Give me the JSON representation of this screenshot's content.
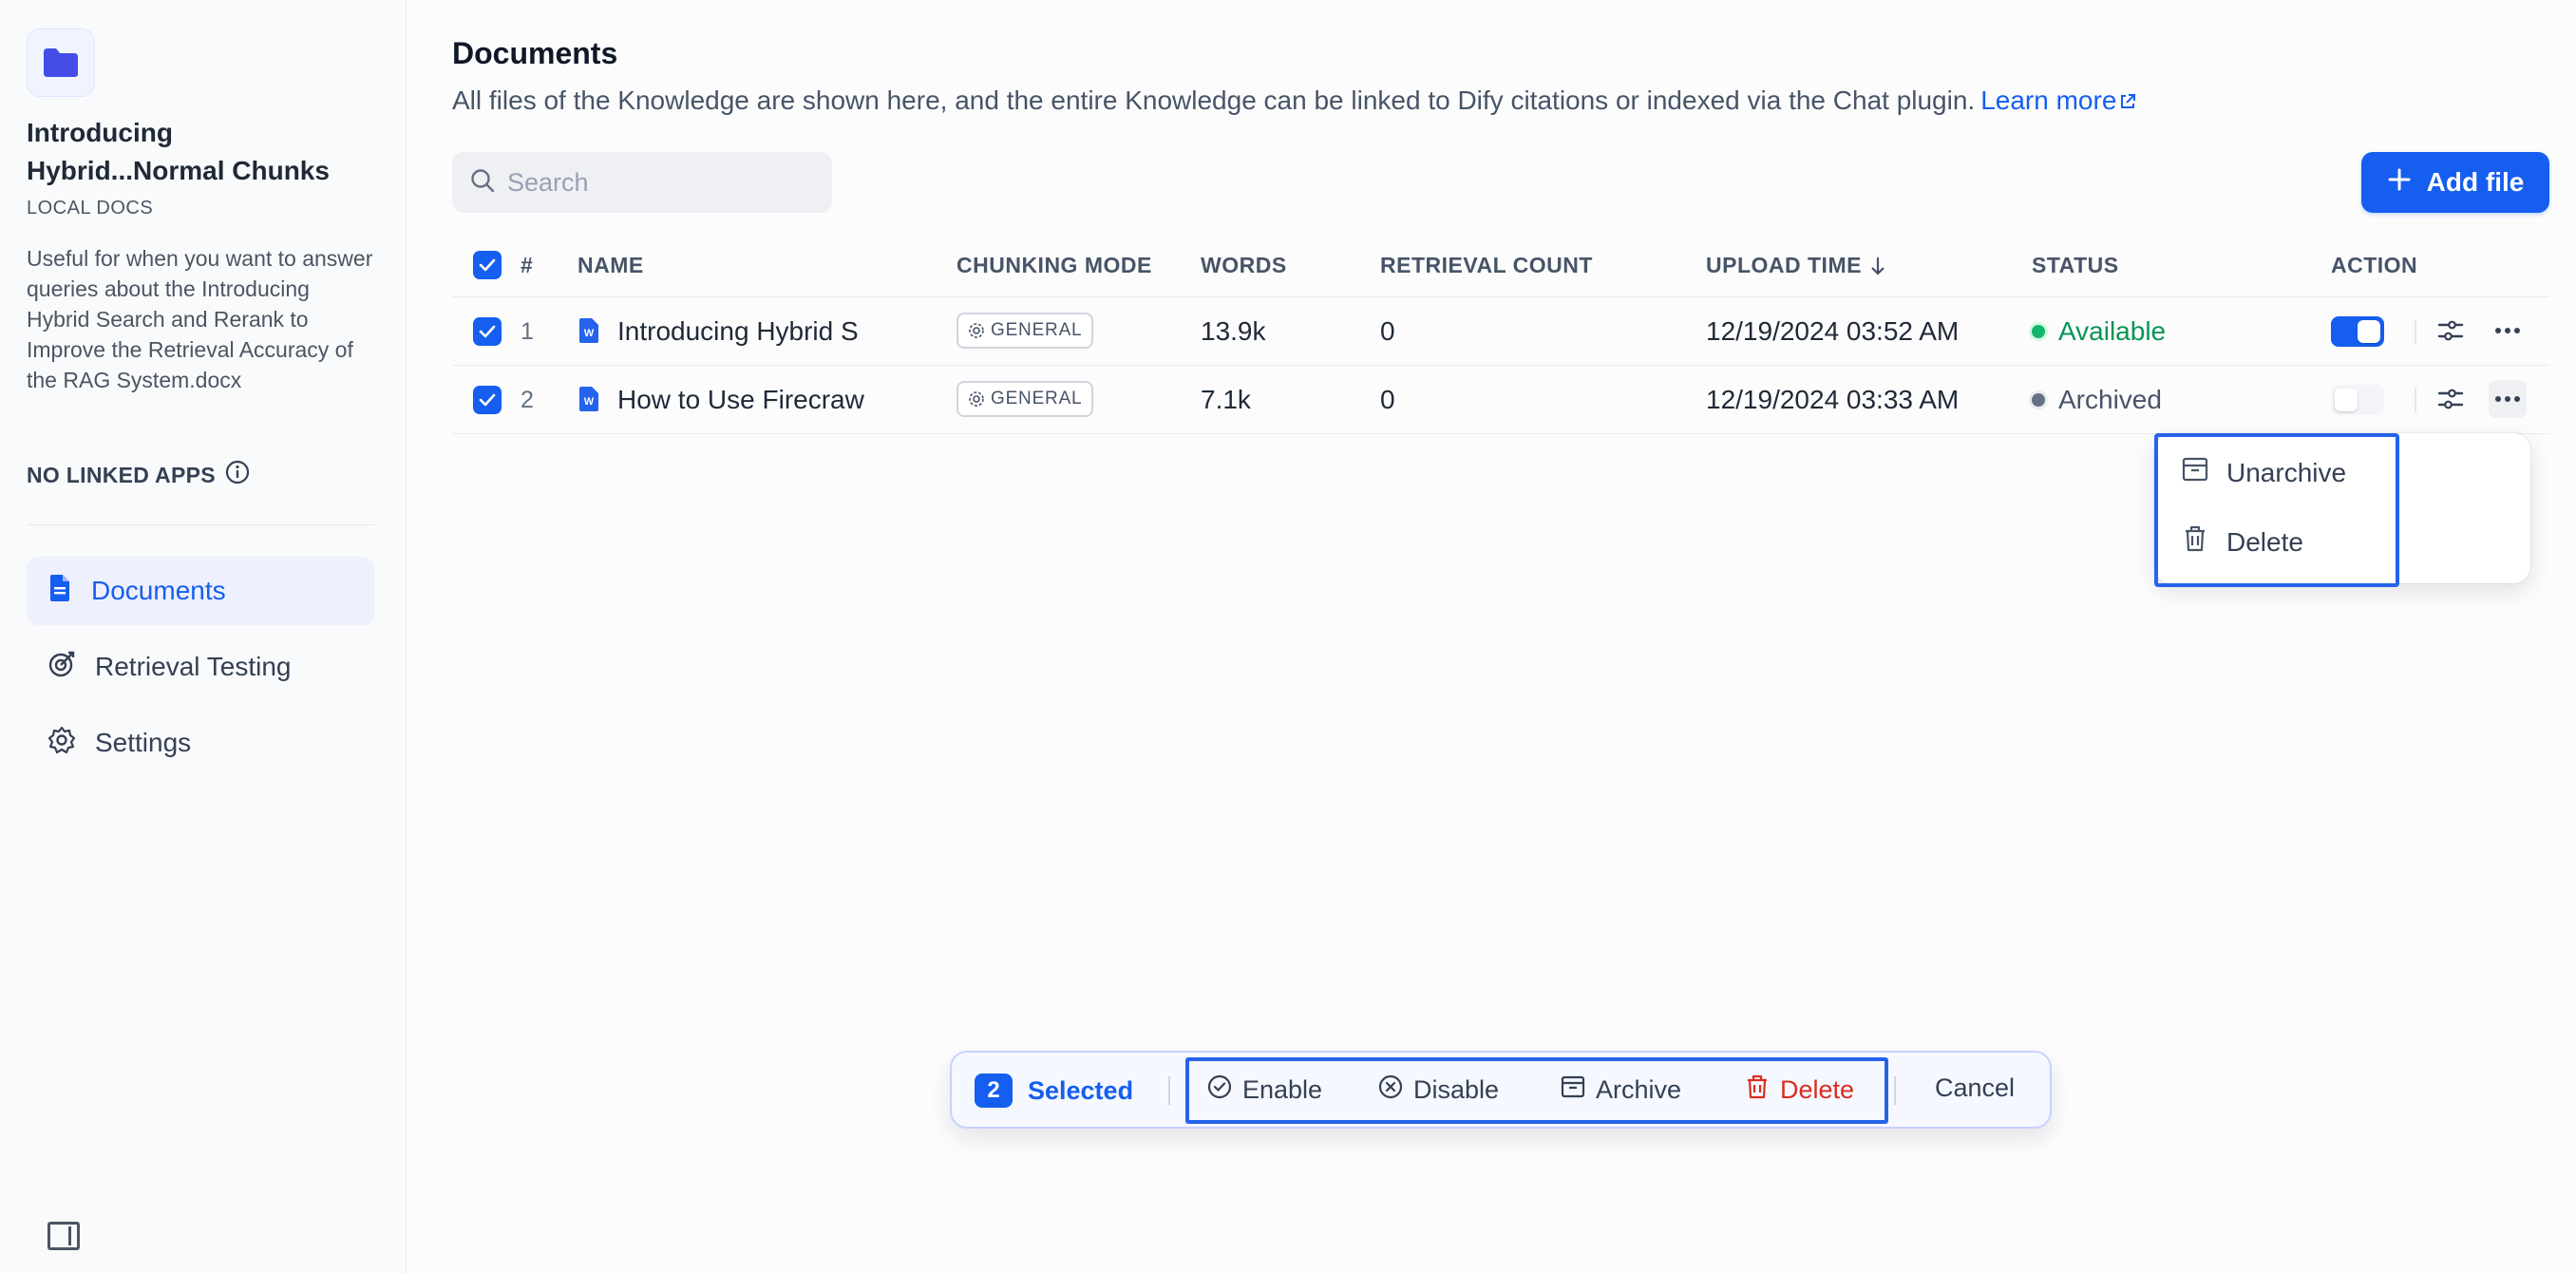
{
  "sidebar": {
    "dataset_title": "Introducing Hybrid...Normal Chunks",
    "dataset_source": "LOCAL DOCS",
    "dataset_description": "Useful for when you want to answer queries about the Introducing Hybrid Search and Rerank to Improve the Retrieval Accuracy of the RAG System.docx",
    "linked_apps_label": "NO LINKED APPS",
    "nav": [
      {
        "label": "Documents",
        "icon": "document-icon",
        "active": true
      },
      {
        "label": "Retrieval Testing",
        "icon": "target-icon",
        "active": false
      },
      {
        "label": "Settings",
        "icon": "gear-icon",
        "active": false
      }
    ]
  },
  "header": {
    "title": "Documents",
    "description": "All files of the Knowledge are shown here, and the entire Knowledge can be linked to Dify citations or indexed via the Chat plugin.",
    "learn_more": "Learn more"
  },
  "toolbar": {
    "search_placeholder": "Search",
    "add_file_label": "Add file"
  },
  "table": {
    "columns": {
      "index": "#",
      "name": "NAME",
      "chunking": "CHUNKING MODE",
      "words": "WORDS",
      "retrieval": "RETRIEVAL COUNT",
      "upload": "UPLOAD TIME",
      "status": "STATUS",
      "action": "ACTION"
    },
    "rows": [
      {
        "index": "1",
        "name": "Introducing Hybrid S",
        "chunking": "GENERAL",
        "words": "13.9k",
        "retrieval": "0",
        "upload_time": "12/19/2024 03:52 AM",
        "status": "Available",
        "enabled": true
      },
      {
        "index": "2",
        "name": "How to Use Firecraw",
        "chunking": "GENERAL",
        "words": "7.1k",
        "retrieval": "0",
        "upload_time": "12/19/2024 03:33 AM",
        "status": "Archived",
        "enabled": false
      }
    ]
  },
  "row_menu": {
    "unarchive": "Unarchive",
    "delete": "Delete"
  },
  "batch_bar": {
    "count": "2",
    "selected_label": "Selected",
    "enable": "Enable",
    "disable": "Disable",
    "archive": "Archive",
    "delete": "Delete",
    "cancel": "Cancel"
  },
  "colors": {
    "accent": "#155eef",
    "available": "#12b76a",
    "archived": "#667085",
    "danger": "#d92d20",
    "highlight": "#2563eb"
  }
}
